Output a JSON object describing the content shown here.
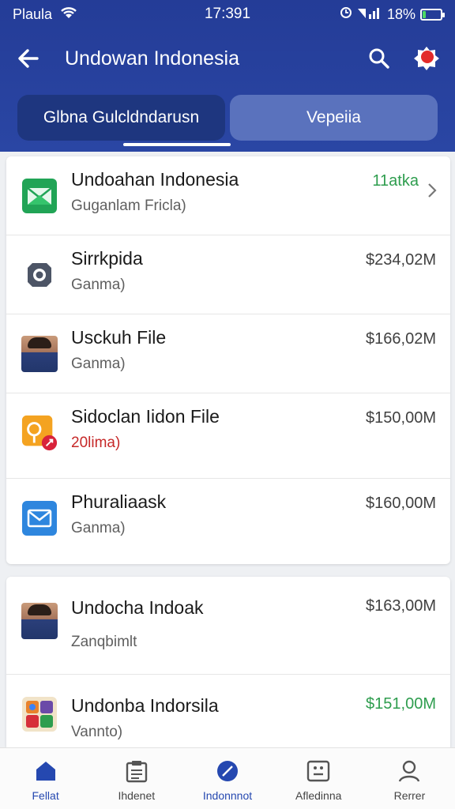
{
  "status_bar": {
    "carrier": "Plaula",
    "time": "17:391",
    "battery_percent": "18%",
    "battery_level": 0.18
  },
  "header": {
    "title": "Undowan Indonesia"
  },
  "tabs": [
    {
      "label": "Glbna Gulcldndarusn",
      "active": true
    },
    {
      "label": "Vepeiia",
      "active": false
    }
  ],
  "list_primary": [
    {
      "title": "Undoahan Indonesia",
      "subtitle": "Guganlam Fricla)",
      "amount": "11atka",
      "amount_color": "green",
      "icon": "green-envelope-icon"
    },
    {
      "title": "Sirrkpida",
      "subtitle": "Ganma)",
      "amount": "$234,02M",
      "icon": "camera-icon"
    },
    {
      "title": "Usckuh File",
      "subtitle": "Ganma)",
      "amount": "$166,02M",
      "icon": "avatar-photo"
    },
    {
      "title": "Sidoclan Iidon File",
      "subtitle": "20lima)",
      "subtitle_color": "red",
      "amount": "$150,00M",
      "icon": "orange-app-icon"
    },
    {
      "title": "Phuraliaask",
      "subtitle": "Ganma)",
      "amount": "$160,00M",
      "icon": "blue-mail-icon"
    }
  ],
  "list_secondary": [
    {
      "title": "Undocha Indoak",
      "subtitle": "Zanqbimlt",
      "amount": "$163,00M",
      "icon": "avatar-photo"
    },
    {
      "title": "Undonba Indorsila",
      "subtitle": "Vannto)",
      "amount": "$151,00M",
      "amount_color": "green",
      "icon": "colorful-app-icon"
    }
  ],
  "bottom_nav": [
    {
      "label": "Fellat",
      "icon": "home-icon",
      "active": true
    },
    {
      "label": "Ihdenet",
      "icon": "document-icon",
      "active": false
    },
    {
      "label": "Indonnnot",
      "icon": "compass-icon",
      "active": true
    },
    {
      "label": "Afledinna",
      "icon": "grid-icon",
      "active": false
    },
    {
      "label": "Rerrer",
      "icon": "person-icon",
      "active": false
    }
  ],
  "colors": {
    "header": "#243c97",
    "accent_green": "#2e9d4e",
    "accent_red": "#c62828",
    "nav_active": "#2548b0"
  }
}
